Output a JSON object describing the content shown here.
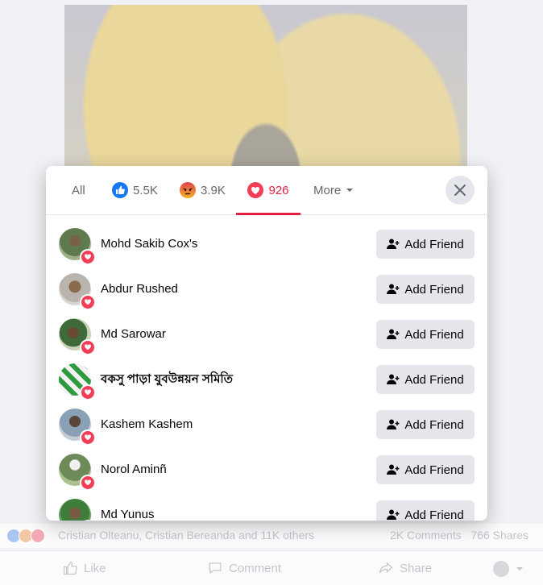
{
  "background": {
    "stats": {
      "names": "Cristian Olteanu, Cristian Bereanda and 11K others",
      "comments": "2K Comments",
      "shares": "766 Shares"
    },
    "actions": {
      "like": "Like",
      "comment": "Comment",
      "share": "Share"
    }
  },
  "tabs": [
    {
      "label": "All",
      "count": ""
    },
    {
      "label": "",
      "count": "5.5K",
      "icon": "like-reaction-icon"
    },
    {
      "label": "",
      "count": "3.9K",
      "icon": "angry-reaction-icon"
    },
    {
      "label": "",
      "count": "926",
      "icon": "love-reaction-icon",
      "active": true
    },
    {
      "label": "More",
      "count": "",
      "icon": "caret-down-icon"
    }
  ],
  "colors": {
    "accent": "#e41e3f",
    "love": "#f33e58",
    "like": "#1877f2",
    "angry": "#e9710f",
    "button_bg": "#e4e6eb"
  },
  "people": [
    {
      "name": "Mohd Sakib Cox's",
      "button": "Add Friend"
    },
    {
      "name": "Abdur Rushed",
      "button": "Add Friend"
    },
    {
      "name": "Md Sarowar",
      "button": "Add Friend"
    },
    {
      "name": "বকসু পাড়া যুবউন্নয়ন সমিতি",
      "button": "Add Friend"
    },
    {
      "name": "Kashem Kashem",
      "button": "Add Friend"
    },
    {
      "name": "Norol Aminñ",
      "button": "Add Friend"
    },
    {
      "name": "Md Yunus",
      "button": "Add Friend"
    }
  ]
}
